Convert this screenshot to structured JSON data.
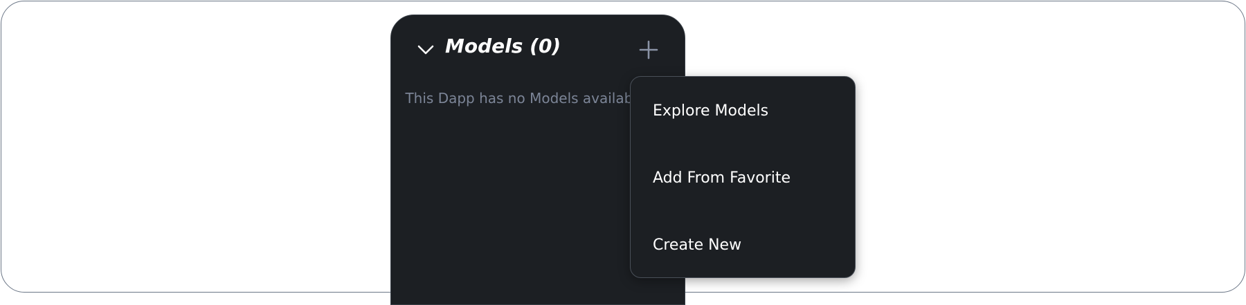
{
  "panel": {
    "title": "Models (0)",
    "empty_message": "This Dapp has no Models available yet",
    "collapse_icon": "chevron-down-icon",
    "add_icon": "plus-icon"
  },
  "dropdown": {
    "items": [
      {
        "label": "Explore Models"
      },
      {
        "label": "Add From Favorite"
      },
      {
        "label": "Create New"
      }
    ]
  },
  "colors": {
    "panel_bg": "#1c1f23",
    "title_text": "#ffffff",
    "muted_text": "#7c8597",
    "plus_icon": "#8a93a6",
    "frame_border": "#6b7686"
  }
}
